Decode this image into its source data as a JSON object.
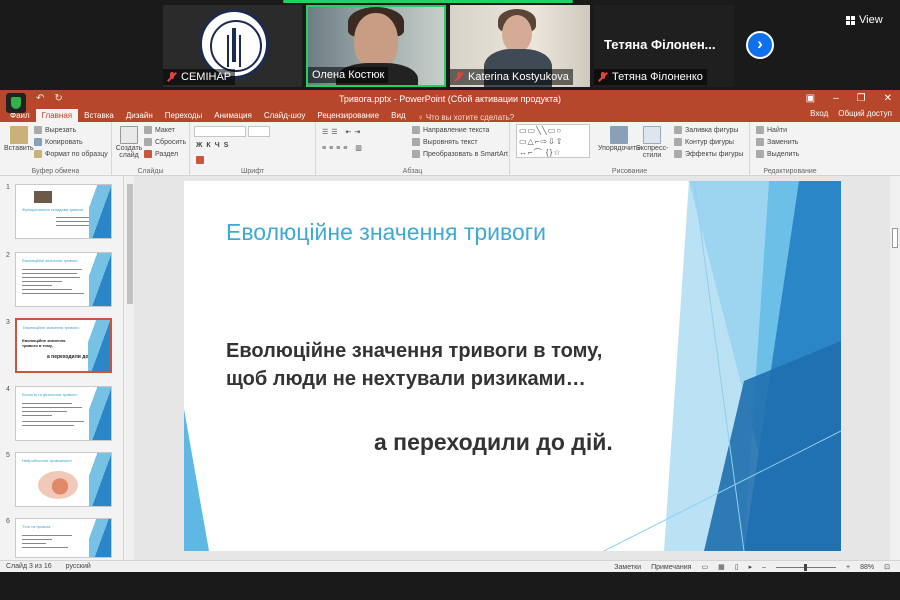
{
  "zoom": {
    "view_label": "View",
    "participants": [
      {
        "name": "СЕМІНАР"
      },
      {
        "name": "Олена Костюк"
      },
      {
        "name": "Katerina Kostyukova"
      },
      {
        "name": "Тетяна Філоненко",
        "display_name": "Тетяна Філонен..."
      }
    ]
  },
  "app": {
    "title": "Тривога.pptx - PowerPoint (Сбой активации продукта)",
    "qat_undo": "↶",
    "qat_redo": "↻",
    "win_controls": [
      "▣",
      "–",
      "❐",
      "✕"
    ],
    "tabs": [
      "Файл",
      "Главная",
      "Вставка",
      "Дизайн",
      "Переходы",
      "Анимация",
      "Слайд-шоу",
      "Рецензирование",
      "Вид"
    ],
    "active_tab": "Главная",
    "tell_me": "♀ Что вы хотите сделать?",
    "signin": "Вход",
    "share": "Общий доступ"
  },
  "ribbon": {
    "paste": "Вставить",
    "cut": "Вырезать",
    "copy": "Копировать",
    "format_painter": "Формат по образцу",
    "clipboard_group": "Буфер обмена",
    "new_slide": "Создать слайд",
    "layout": "Макет",
    "reset": "Сбросить",
    "section": "Раздел",
    "slides_group": "Слайды",
    "font_group": "Шрифт",
    "text_direction": "Направление текста",
    "align_text": "Выровнять текст",
    "smartart": "Преобразовать в SmartArt",
    "paragraph_group": "Абзац",
    "arrange": "Упорядочить",
    "quick_styles": "Экспресс-стили",
    "shape_fill": "Заливка фигуры",
    "shape_outline": "Контур фигуры",
    "shape_effects": "Эффекты фигуры",
    "drawing_group": "Рисование",
    "find": "Найти",
    "replace": "Заменить",
    "select": "Выделить",
    "editing_group": "Редактирование",
    "shapes_glyphs": "▭▭╲╲▭○ ▭△⌐⇨⇩⇧ ↔⌐⌒ {}☆"
  },
  "thumbnails": [
    {
      "num": "1",
      "title": "Функціональна складова тривоги"
    },
    {
      "num": "2",
      "title": "Еволюційне значення тривоги"
    },
    {
      "num": "3",
      "title": "Еволюційне значення тривоги",
      "selected": true
    },
    {
      "num": "4",
      "title": "Біологія та фізіологія тривоги"
    },
    {
      "num": "5",
      "title": "Нейробіологія тривожності"
    },
    {
      "num": "6",
      "title": "Тіло та тривога"
    }
  ],
  "slide": {
    "title": "Еволюційне значення тривоги",
    "body_line1": "Еволюційне значення тривоги в тому,",
    "body_line2": "щоб люди не нехтували ризиками…",
    "tail": "а переходили до дій."
  },
  "status": {
    "slide_counter": "Слайд 3 из 16",
    "language": "русский",
    "notes": "Заметки",
    "comments": "Примечания",
    "zoom_level": "88%"
  }
}
